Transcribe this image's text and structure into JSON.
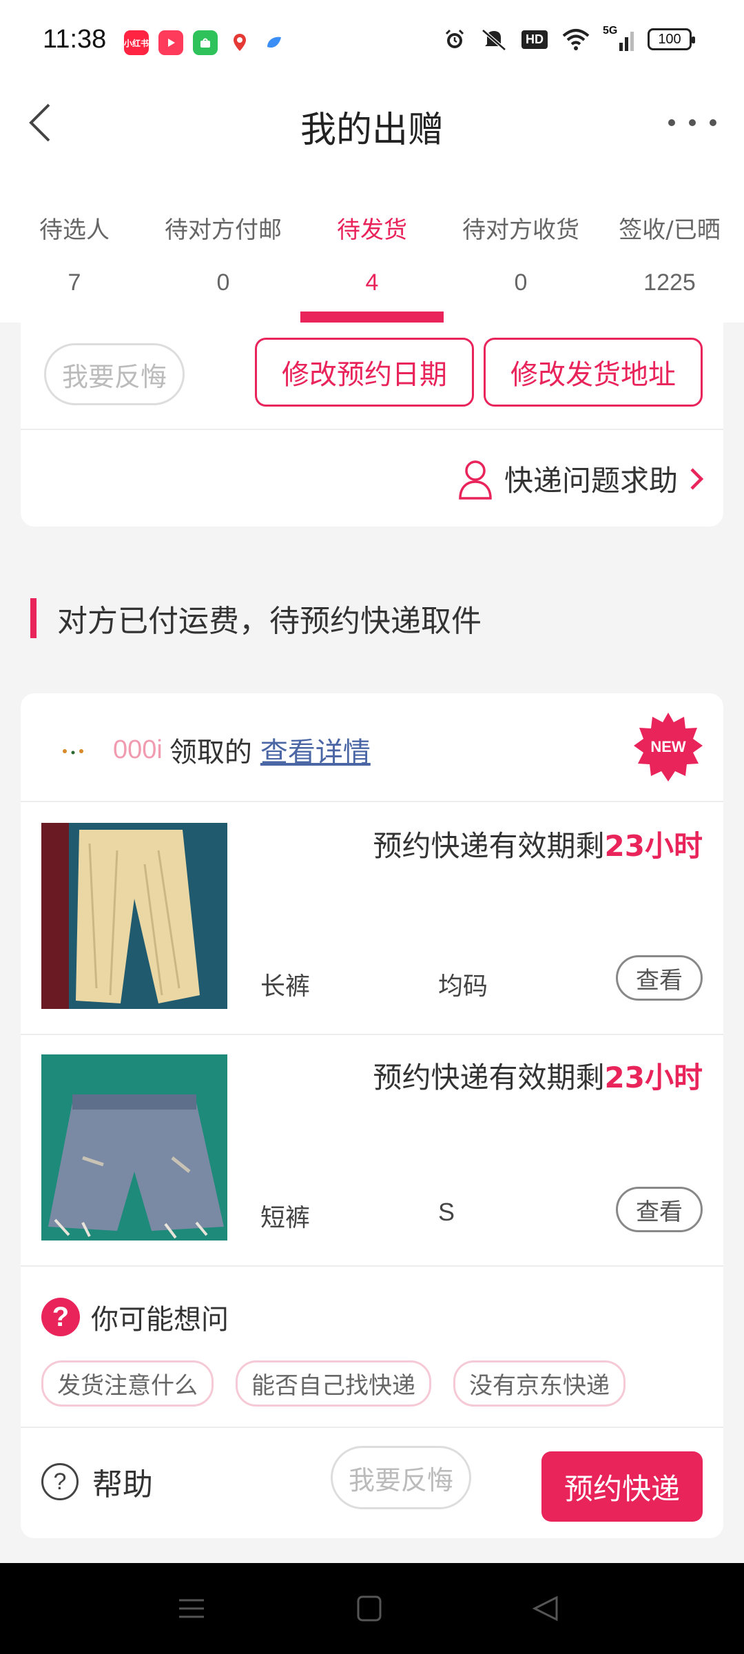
{
  "status_bar": {
    "time": "11:38",
    "app_icons": [
      {
        "name": "xiaohongshu-app-icon",
        "label": "小红书",
        "color": "#ff2442"
      },
      {
        "name": "video-app-icon",
        "label": "",
        "color": "#ff3b5c"
      },
      {
        "name": "shop-app-icon",
        "label": "",
        "color": "#2fc25b"
      },
      {
        "name": "map-app-icon",
        "label": "",
        "color": "#ffffff"
      },
      {
        "name": "browser-app-icon",
        "label": "",
        "color": "#3a8ef6"
      }
    ],
    "network": "5G",
    "hd": "HD",
    "battery": "100"
  },
  "header": {
    "title": "我的出赠"
  },
  "tabs": [
    {
      "label": "待选人",
      "count": "7"
    },
    {
      "label": "待对方付邮",
      "count": "0"
    },
    {
      "label": "待发货",
      "count": "4"
    },
    {
      "label": "待对方收货",
      "count": "0"
    },
    {
      "label": "签收/已晒",
      "count": "1225"
    }
  ],
  "card_top": {
    "regret_label": "我要反悔",
    "change_date_label": "修改预约日期",
    "change_address_label": "修改发货地址",
    "courier_help_label": "快递问题求助"
  },
  "section": {
    "title": "对方已付运费，待预约快递取件"
  },
  "order": {
    "user": "000i",
    "claimed_text": "领取的",
    "detail_link": "查看详情",
    "new_badge": "NEW",
    "items": [
      {
        "expiry_prefix": "预约快递有效期剩",
        "expiry_value": "23小时",
        "name": "长裤",
        "size": "均码",
        "view_label": "查看"
      },
      {
        "expiry_prefix": "预约快递有效期剩",
        "expiry_value": "23小时",
        "name": "短裤",
        "size": "S",
        "view_label": "查看"
      }
    ],
    "faq": {
      "title": "你可能想问",
      "tags": [
        "发货注意什么",
        "能否自己找快递",
        "没有京东快递"
      ]
    },
    "bottom": {
      "help_label": "帮助",
      "regret_label": "我要反悔",
      "book_label": "预约快递"
    }
  },
  "colors": {
    "accent": "#e8245b",
    "link": "#4a66a5"
  }
}
